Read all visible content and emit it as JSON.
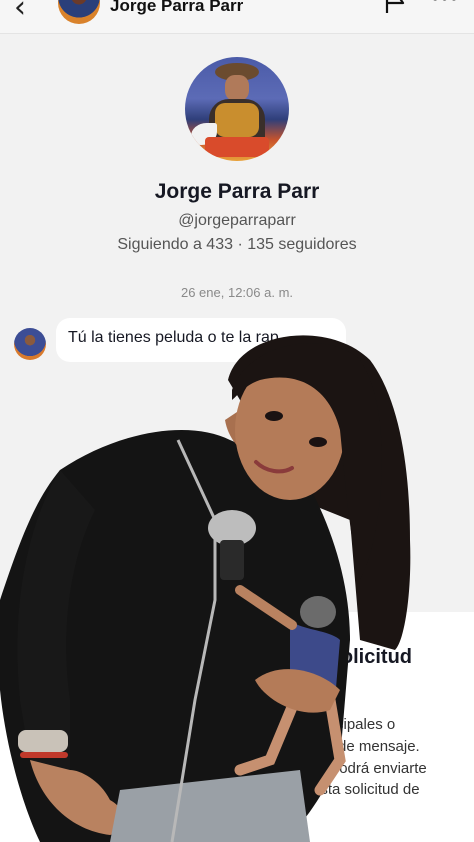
{
  "header": {
    "back_icon": "back-arrow-icon",
    "title": "Jorge Parra Parr",
    "flag_icon": "flag-icon",
    "more_icon": "more-dots-icon"
  },
  "profile": {
    "name": "Jorge Parra Parr",
    "handle": "@jorgeparraparr",
    "stats": "Siguiendo a 433 · 135 seguidores"
  },
  "chat": {
    "timestamp": "26 ene, 12:06 a. m.",
    "message": "Tú la tienes peluda o te la rap"
  },
  "sheet": {
    "title_fragment": "n solicitud",
    "line1": "cipales o",
    "line2": "de mensaje.",
    "line3": "no podrá enviarte",
    "line4": "esta solicitud de"
  }
}
